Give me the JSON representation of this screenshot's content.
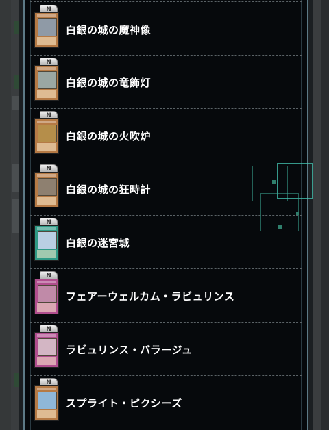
{
  "cards": [
    {
      "rarity": "N",
      "name": "白銀の城の魔神像",
      "frame": "#b57a45",
      "art": "#8f9aa6"
    },
    {
      "rarity": "N",
      "name": "白銀の城の竜飾灯",
      "frame": "#b57a45",
      "art": "#9aa7a3"
    },
    {
      "rarity": "N",
      "name": "白銀の城の火吹炉",
      "frame": "#b57a45",
      "art": "#b58e4a"
    },
    {
      "rarity": "N",
      "name": "白銀の城の狂時計",
      "frame": "#b57a45",
      "art": "#8e8070"
    },
    {
      "rarity": "N",
      "name": "白銀の迷宮城",
      "frame": "#2f9a86",
      "art": "#b9cfe3"
    },
    {
      "rarity": "N",
      "name": "フェアーウェルカム・ラビュリンス",
      "frame": "#b04e8e",
      "art": "#c08aa8"
    },
    {
      "rarity": "N",
      "name": "ラビュリンス・バラージュ",
      "frame": "#b04e8e",
      "art": "#d3b6c4"
    },
    {
      "rarity": "N",
      "name": "スプライト・ピクシーズ",
      "frame": "#b57a45",
      "art": "#8fb7d8"
    }
  ],
  "colors": {
    "panel_bg": "#06090c",
    "panel_border": "#5d7a86",
    "divider": "#5a6266",
    "text": "#ffffff"
  }
}
